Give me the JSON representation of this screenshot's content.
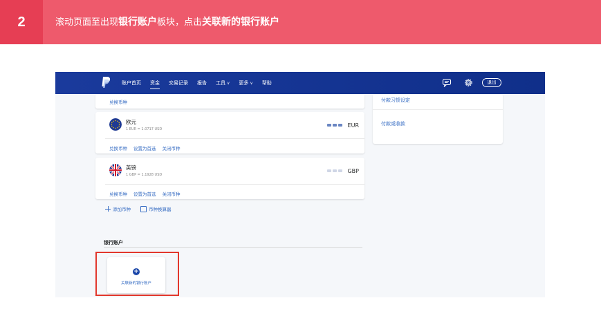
{
  "banner": {
    "step": "2",
    "text_1": "滚动页面至出现",
    "bold_1": "银行账户",
    "text_2": "板块，点击",
    "bold_2": "关联新的银行账户"
  },
  "nav": {
    "items": [
      {
        "label": "账户首页"
      },
      {
        "label": "资金"
      },
      {
        "label": "交易记录"
      },
      {
        "label": "报告"
      },
      {
        "label": "工具",
        "caret": "∨"
      },
      {
        "label": "更多",
        "caret": "∨"
      },
      {
        "label": "帮助"
      }
    ],
    "logout": "退出"
  },
  "top_card": {
    "convert": "兑换币种"
  },
  "currencies": [
    {
      "name": "欧元",
      "rate": "1 EUR = 1.0717 USD",
      "code": "EUR",
      "actions": [
        "兑换币种",
        "设置为首选",
        "关闭币种"
      ]
    },
    {
      "name": "英镑",
      "rate": "1 GBP = 1.1928 USD",
      "code": "GBP",
      "actions": [
        "兑换币种",
        "设置为首选",
        "关闭币种"
      ]
    }
  ],
  "add_currency": "添加币种",
  "converter": "币种换算器",
  "right_panel": {
    "links": [
      "付款习惯设定",
      "付款或收款"
    ]
  },
  "bank": {
    "title": "银行账户",
    "link_label": "关联新的银行账户"
  },
  "colors": {
    "banner": "#ee5a6c",
    "step_box": "#e63e54",
    "nav": "#16329a",
    "link": "#3a6fc4",
    "highlight": "#e2372c"
  }
}
